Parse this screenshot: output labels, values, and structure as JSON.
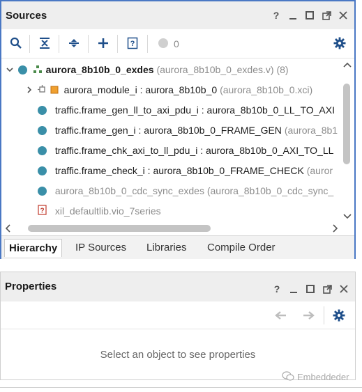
{
  "sources": {
    "title": "Sources",
    "header_buttons": [
      "?",
      "minimize",
      "restore",
      "float",
      "close"
    ],
    "toolbar": {
      "icons": [
        "search-icon",
        "collapse-all-icon",
        "expand-all-icon",
        "add-icon",
        "help-doc-icon",
        "status-dot-icon",
        "gear-icon"
      ],
      "count": "0"
    },
    "tree": {
      "root": {
        "name": "aurora_8b10b_0_exdes",
        "detail": "(aurora_8b10b_0_exdes.v) (8)"
      },
      "module": {
        "name": "aurora_module_i : aurora_8b10b_0",
        "detail": "(aurora_8b10b_0.xci)"
      },
      "items": [
        {
          "name": "traffic.frame_gen_ll_to_axi_pdu_i : aurora_8b10b_0_LL_TO_AXI",
          "detail": ""
        },
        {
          "name": "traffic.frame_gen_i : aurora_8b10b_0_FRAME_GEN",
          "detail": "(aurora_8b1"
        },
        {
          "name": "traffic.frame_chk_axi_to_ll_pdu_i : aurora_8b10b_0_AXI_TO_LL",
          "detail": ""
        },
        {
          "name": "traffic.frame_check_i : aurora_8b10b_0_FRAME_CHECK",
          "detail": "(auror"
        }
      ],
      "cdc": {
        "name": "aurora_8b10b_0_cdc_sync_exdes",
        "detail": "(aurora_8b10b_0_cdc_sync_"
      },
      "lib": {
        "name": "xil_defaultlib.vio_7series"
      }
    },
    "tabs": [
      "Hierarchy",
      "IP Sources",
      "Libraries",
      "Compile Order"
    ],
    "active_tab": "Hierarchy"
  },
  "properties": {
    "title": "Properties",
    "empty_message": "Select an object to see properties"
  },
  "watermark": "Embeddeder",
  "colors": {
    "accent_border": "#4a78c4",
    "dot": "#3a8fa8",
    "module_icon": "#f0a030"
  }
}
